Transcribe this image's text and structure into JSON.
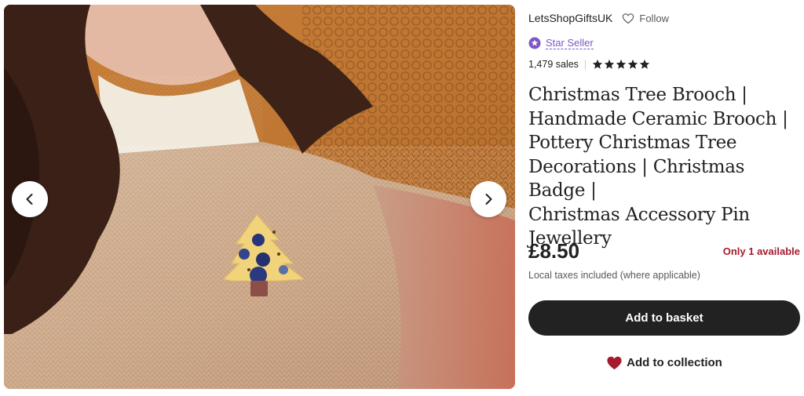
{
  "shop": {
    "name": "LetsShopGiftsUK",
    "follow_label": "Follow",
    "badge_label": "Star Seller",
    "sales": "1,479 sales",
    "rating_stars": 5
  },
  "listing": {
    "title_lines": [
      "Christmas Tree Brooch |",
      "Handmade Ceramic Brooch |",
      "Pottery Christmas Tree",
      "Decorations | Christmas Badge |",
      "Christmas Accessory Pin",
      "Jewellery"
    ],
    "price": "£8.50",
    "availability": "Only 1 available",
    "tax_note": "Local taxes included (where applicable)"
  },
  "actions": {
    "add_to_basket": "Add to basket",
    "add_to_collection": "Add to collection"
  },
  "gallery": {
    "prev_icon": "chevron-left-icon",
    "next_icon": "chevron-right-icon"
  },
  "colors": {
    "star_seller": "#7f56c8",
    "availability": "#a61a2e",
    "primary_button": "#222222",
    "heart": "#a61a2e"
  }
}
